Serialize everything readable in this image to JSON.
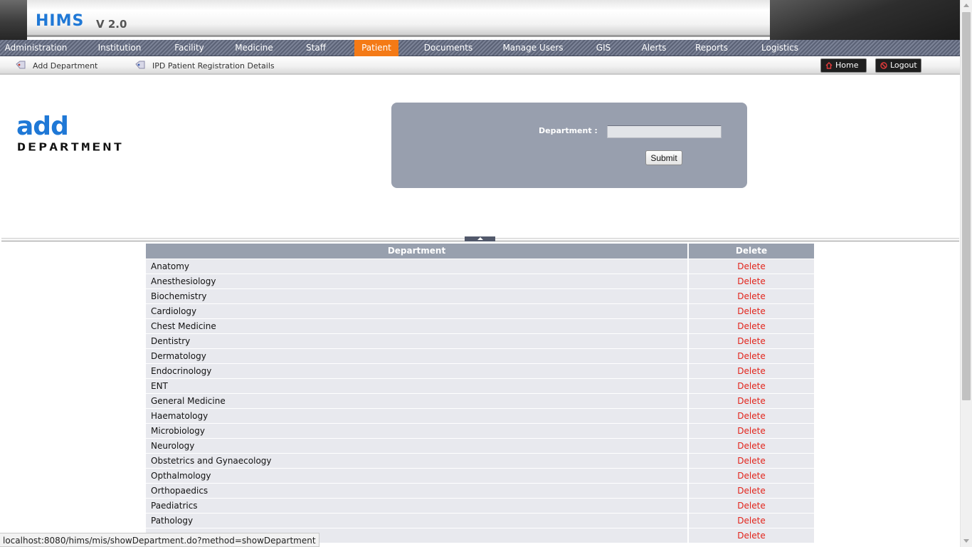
{
  "header": {
    "app_title": "HIMS",
    "app_version": "V 2.0"
  },
  "main_nav": {
    "active_color": "#f47a16",
    "items": [
      {
        "label": "Administration"
      },
      {
        "label": "Institution"
      },
      {
        "label": "Facility"
      },
      {
        "label": "Medicine"
      },
      {
        "label": "Staff"
      },
      {
        "label": "Patient",
        "active": true
      },
      {
        "label": "Documents"
      },
      {
        "label": "Manage Users"
      },
      {
        "label": "GIS"
      },
      {
        "label": "Alerts"
      },
      {
        "label": "Reports"
      },
      {
        "label": "Logistics"
      }
    ]
  },
  "sub_nav": {
    "links": [
      {
        "label": "Add Department",
        "icon": "tag-icon"
      },
      {
        "label": "IPD Patient Registration Details",
        "icon": "tag-icon"
      }
    ],
    "home_label": "Home",
    "logout_label": "Logout"
  },
  "logo": {
    "line1": "add",
    "line2": "DEPARTMENT"
  },
  "form": {
    "department_label": "Department :",
    "department_value": "",
    "submit_label": "Submit"
  },
  "table": {
    "headers": {
      "department": "Department",
      "delete": "Delete"
    },
    "delete_label": "Delete",
    "delete_color": "#e2231a",
    "rows": [
      "Anatomy",
      "Anesthesiology",
      "Biochemistry",
      "Cardiology",
      "Chest Medicine",
      "Dentistry",
      "Dermatology",
      "Endocrinology",
      "ENT",
      "General Medicine",
      "Haematology",
      "Microbiology",
      "Neurology",
      "Obstetrics and Gynaecology",
      "Opthalmology",
      "Orthopaedics",
      "Paediatrics",
      "Pathology",
      ""
    ]
  },
  "status_bar": {
    "url": "localhost:8080/hims/mis/showDepartment.do?method=showDepartment"
  }
}
